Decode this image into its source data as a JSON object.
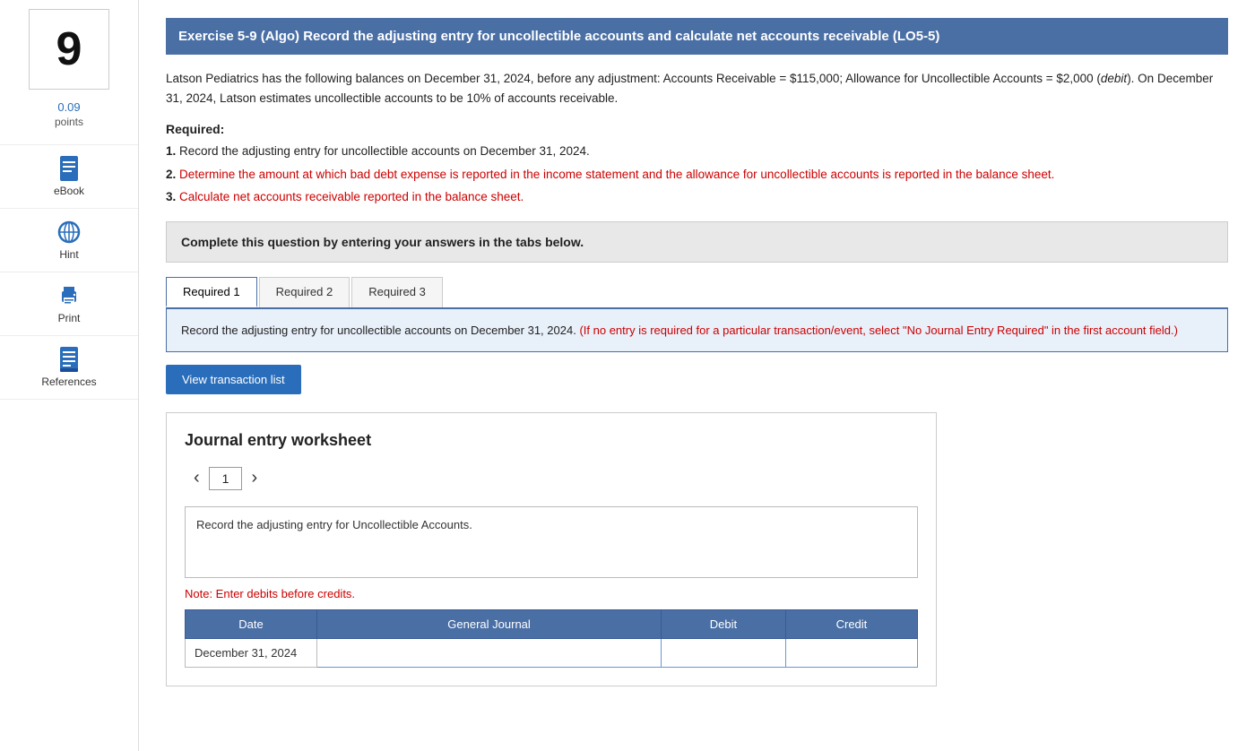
{
  "sidebar": {
    "question_number": "9",
    "points_value": "0.09",
    "points_label": "points",
    "items": [
      {
        "id": "ebook",
        "label": "eBook",
        "icon": "book-icon"
      },
      {
        "id": "hint",
        "label": "Hint",
        "icon": "globe-icon"
      },
      {
        "id": "print",
        "label": "Print",
        "icon": "print-icon"
      },
      {
        "id": "references",
        "label": "References",
        "icon": "ref-icon"
      }
    ]
  },
  "exercise": {
    "title": "Exercise 5-9 (Algo) Record the adjusting entry for uncollectible accounts and calculate net accounts receivable (LO5-5)",
    "problem_text": "Latson Pediatrics has the following balances on December 31, 2024, before any adjustment: Accounts Receivable = $115,000; Allowance for Uncollectible Accounts = $2,000 (debit). On December 31, 2024, Latson estimates uncollectible accounts to be 10% of accounts receivable.",
    "required_label": "Required:",
    "requirements": [
      "Record the adjusting entry for uncollectible accounts on December 31, 2024.",
      "Determine the amount at which bad debt expense is reported in the income statement and the allowance for uncollectible accounts is reported in the balance sheet.",
      "Calculate net accounts receivable reported in the balance sheet."
    ],
    "complete_banner": "Complete this question by entering your answers in the tabs below."
  },
  "tabs": {
    "items": [
      {
        "label": "Required 1",
        "active": true
      },
      {
        "label": "Required 2",
        "active": false
      },
      {
        "label": "Required 3",
        "active": false
      }
    ]
  },
  "tab_content": {
    "main_text": "Record the adjusting entry for uncollectible accounts on December 31, 2024.",
    "note_text": "(If no entry is required for a particular transaction/event, select \"No Journal Entry Required\" in the first account field.)"
  },
  "transaction_button": "View transaction list",
  "worksheet": {
    "title": "Journal entry worksheet",
    "page_number": "1",
    "nav_prev": "‹",
    "nav_next": "›",
    "entry_description": "Record the adjusting entry for Uncollectible Accounts.",
    "note": "Note: Enter debits before credits.",
    "table": {
      "headers": [
        "Date",
        "General Journal",
        "Debit",
        "Credit"
      ],
      "rows": [
        {
          "date": "December 31, 2024",
          "general_journal": "",
          "debit": "",
          "credit": ""
        }
      ]
    }
  }
}
